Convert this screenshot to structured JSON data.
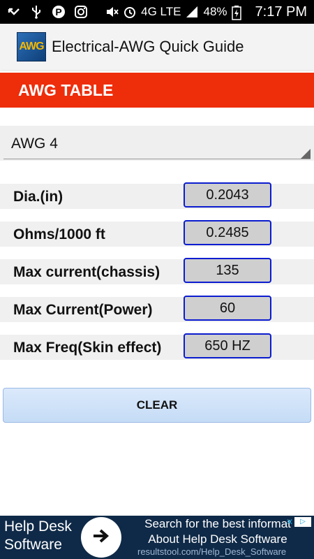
{
  "status_bar": {
    "network": "4G LTE",
    "battery": "48%",
    "time": "7:17 PM"
  },
  "app_bar": {
    "logo_text": "AWG",
    "title": "Electrical-AWG Quick Guide"
  },
  "section": {
    "header": "AWG TABLE"
  },
  "gauge_selector": {
    "selected": "AWG 4"
  },
  "properties": [
    {
      "label": "Dia.(in)",
      "value": "0.2043"
    },
    {
      "label": "Ohms/1000 ft",
      "value": "0.2485"
    },
    {
      "label": "Max current(chassis)",
      "value": "135"
    },
    {
      "label": "Max Current(Power)",
      "value": "60"
    },
    {
      "label": "Max Freq(Skin effect)",
      "value": "650 HZ"
    }
  ],
  "actions": {
    "clear_label": "CLEAR"
  },
  "ad": {
    "title": "Help Desk Software",
    "description_line1": "Search for the best informat",
    "description_line2": "About Help Desk Software",
    "url": "resultstool.com/Help_Desk_Software"
  },
  "colors": {
    "header_red": "#ee2d0a",
    "value_border_blue": "#0b1ccf",
    "ad_background": "#0f2a48"
  }
}
